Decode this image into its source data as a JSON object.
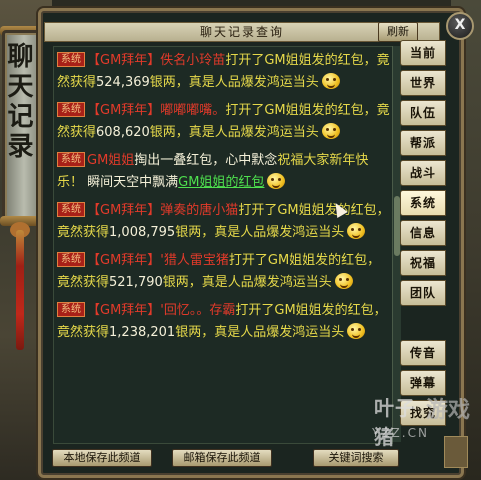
{
  "window": {
    "title": "聊天记录查询",
    "refresh_label": "刷新",
    "close_label": "X"
  },
  "side_banner": {
    "title": "聊天记录"
  },
  "messages": [
    {
      "tag": "系统",
      "sender": "【GM拜年】",
      "name": "佚名小玲苗",
      "text1": "打开了GM姐姐发的红包，竟然获得",
      "amount": "524,369",
      "text2": "银两，真是人品爆发鸿运当头"
    },
    {
      "tag": "系统",
      "sender": "【GM拜年】",
      "name": "嘟嘟嘟嘴。",
      "text1": "打开了GM姐姐发的红包，竟然获得",
      "amount": "608,620",
      "text2": "银两，真是人品爆发鸿运当头"
    },
    {
      "tag": "系统",
      "sender": "GM姐姐",
      "text1": "掏出一叠红包，心中默念",
      "wish": "祝福大家新年快乐！",
      "text2": "瞬间天空中飘满",
      "link": "GM姐姐的红包"
    },
    {
      "tag": "系统",
      "sender": "【GM拜年】",
      "name": "弹奏的唐小猫",
      "text1": "打开了GM姐姐发的红包，竟然获得",
      "amount": "1,008,795",
      "text2": "银两，真是人品爆发鸿运当头"
    },
    {
      "tag": "系统",
      "sender": "【GM拜年】",
      "name": "'猎人雷宝猪",
      "text1": "打开了GM姐姐发的红包，竟然获得",
      "amount": "521,790",
      "text2": "银两，真是人品爆发鸿运当头"
    },
    {
      "tag": "系统",
      "sender": "【GM拜年】",
      "name": "'回忆。。存霸",
      "text1": "打开了GM姐姐发的红包，竟然获得",
      "amount": "1,238,201",
      "text2": "银两，真是人品爆发鸿运当头"
    }
  ],
  "tabs": [
    {
      "label": "当前"
    },
    {
      "label": "世界"
    },
    {
      "label": "队伍"
    },
    {
      "label": "帮派"
    },
    {
      "label": "战斗"
    },
    {
      "label": "系统"
    },
    {
      "label": "信息"
    },
    {
      "label": "祝福"
    },
    {
      "label": "团队"
    },
    {
      "label": "传音"
    },
    {
      "label": "弹幕"
    },
    {
      "label": "找究"
    }
  ],
  "bottom_buttons": {
    "save_local": "本地保存此频道",
    "save_mail": "邮箱保存此频道",
    "keyword_search": "关键词搜索"
  },
  "watermark": {
    "brand": "叶子猪",
    "brand2": "游戏",
    "url": "YZZ.CN"
  },
  "colors": {
    "system_tag_bg": "#a82018",
    "sender": "#e23a2a",
    "message_text": "#e6d94a",
    "link": "#4ee04e"
  }
}
